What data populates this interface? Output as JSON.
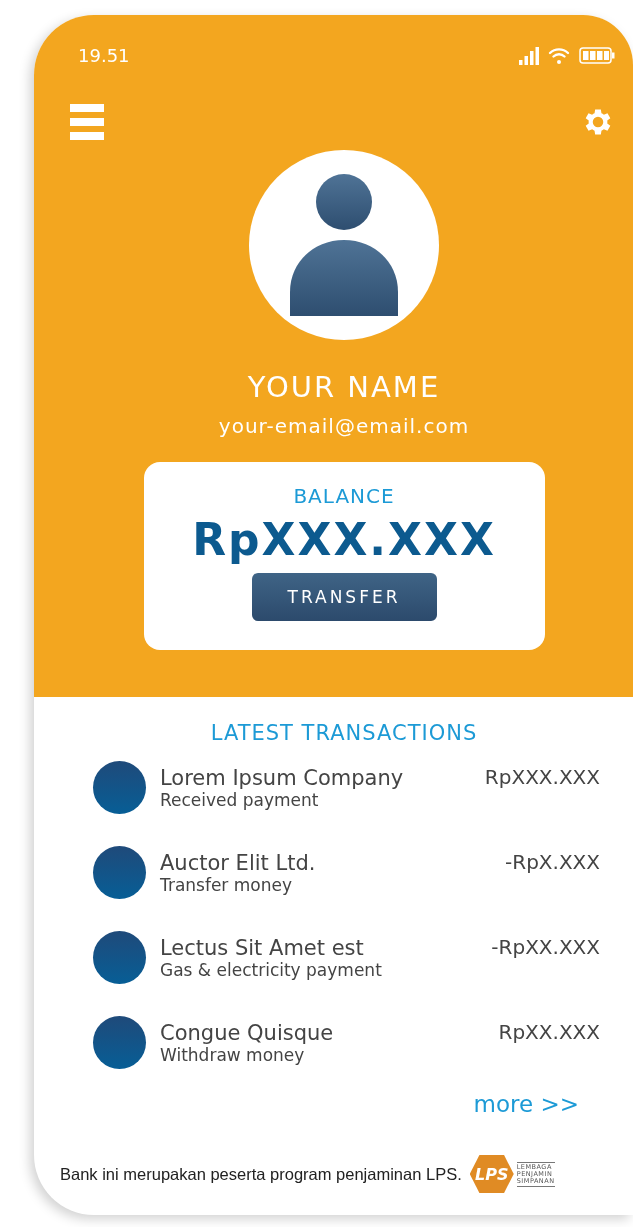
{
  "status_bar": {
    "time": "19.51"
  },
  "profile": {
    "name": "YOUR NAME",
    "email": "your-email@email.com"
  },
  "balance": {
    "label": "BALANCE",
    "amount": "RpXXX.XXX",
    "button": "TRANSFER"
  },
  "transactions": {
    "title": "LATEST TRANSACTIONS",
    "items": [
      {
        "name": "Lorem Ipsum Company",
        "description": "Received payment",
        "amount": "RpXXX.XXX"
      },
      {
        "name": "Auctor Elit Ltd.",
        "description": "Transfer money",
        "amount": "-RpX.XXX"
      },
      {
        "name": "Lectus Sit Amet est",
        "description": "Gas & electricity payment",
        "amount": "-RpXX.XXX"
      },
      {
        "name": "Congue Quisque",
        "description": "Withdraw money",
        "amount": "RpXX.XXX"
      }
    ],
    "more": "more >>"
  },
  "footer": {
    "text": "Bank ini merupakan peserta program penjaminan LPS.",
    "logo_mark": "LPS",
    "logo_lines": [
      "LEMBAGA",
      "PENJAMIN",
      "SIMPANAN"
    ]
  }
}
